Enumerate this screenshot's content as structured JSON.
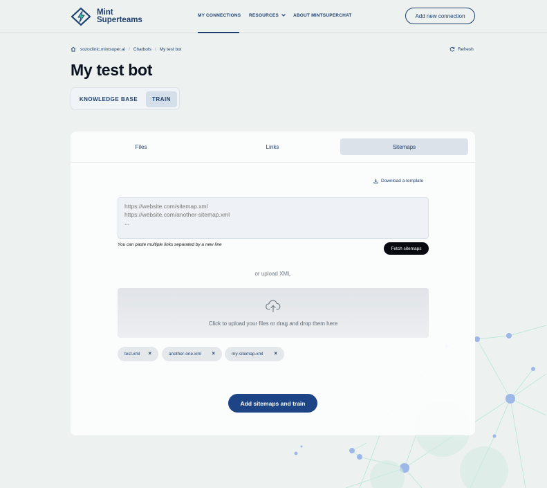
{
  "header": {
    "logo_line1": "Mint",
    "logo_line2": "Superteams",
    "nav": {
      "my_connections": "MY CONNECTIONS",
      "resources": "RESOURCES",
      "about": "ABOUT MINTSUPERCHAT"
    },
    "add_connection_label": "Add new connection"
  },
  "breadcrumb": {
    "items": [
      "sozoclinic.mintsuper.ai",
      "Chatbots",
      "My test bot"
    ],
    "separator": "/"
  },
  "refresh_label": "Refresh",
  "page_title": "My test bot",
  "mode_toggle": {
    "knowledge_base": "KNOWLEDGE BASE",
    "train": "TRAIN",
    "selected": "TRAIN"
  },
  "tabs": {
    "files": "Files",
    "links": "Links",
    "sitemaps": "Sitemaps",
    "selected": "Sitemaps"
  },
  "download_template_label": "Download a template",
  "sitemap_input": {
    "placeholder": "https://website.com/sitemap.xml\nhttps://website.com/another-sitemap.xml\n...",
    "value": ""
  },
  "hint": "You can paste multiple links separated by a new line",
  "fetch_label": "Fetch sitemaps",
  "or_upload": "or upload XML",
  "dropzone_text": "Click to upload your files or drag and drop them here",
  "files": [
    {
      "name": "test.xml"
    },
    {
      "name": "another-one.xml"
    },
    {
      "name": "my-sitemap.xml"
    }
  ],
  "remove_symbol": "×",
  "submit_label": "Add sitemaps and train",
  "colors": {
    "brand": "#1d3f6e",
    "primary_button": "#1d4585",
    "background": "#edf1f0",
    "fetch_button": "#070b10",
    "accent_green": "#3ec9a0"
  },
  "icons": {
    "home": "home-icon",
    "refresh": "refresh-icon",
    "download": "download-icon",
    "upload": "cloud-upload-icon",
    "chevron": "chevron-down-icon",
    "logo": "lightning-diamond-icon"
  }
}
